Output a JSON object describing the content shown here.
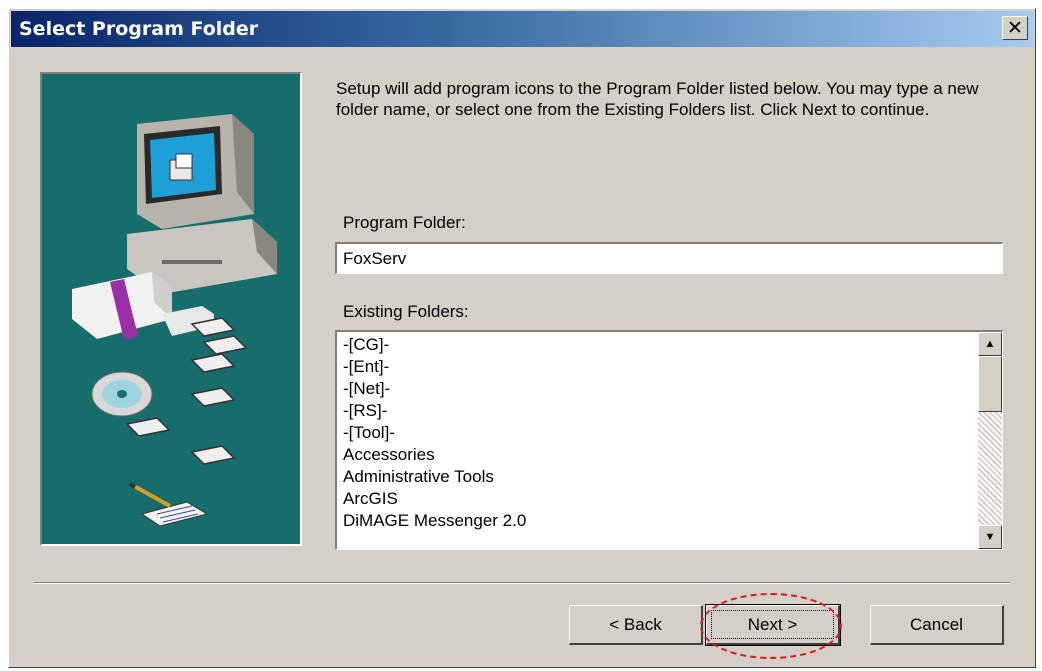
{
  "window": {
    "title": "Select Program Folder",
    "close_glyph": "✕"
  },
  "description": "Setup will add program icons to the Program Folder listed below. You may type a new folder name, or select one from the Existing Folders list. Click Next to continue.",
  "program_folder": {
    "label": "Program Folder:",
    "value": "FoxServ"
  },
  "existing_folders": {
    "label": "Existing Folders:",
    "items": [
      "-[CG]-",
      "-[Ent]-",
      "-[Net]-",
      "-[RS]-",
      "-[Tool]-",
      "Accessories",
      "Administrative Tools",
      "ArcGIS",
      "DiMAGE Messenger 2.0"
    ]
  },
  "buttons": {
    "back": "< Back",
    "next": "Next >",
    "cancel": "Cancel"
  },
  "icons": {
    "artwork": "setup-wizard-computer-icon",
    "scroll_up": "scroll-up-arrow-icon",
    "scroll_down": "scroll-down-arrow-icon"
  },
  "colors": {
    "title_bar_start": "#0a246a",
    "title_bar_end": "#a6caf0",
    "dialog_face": "#d4d0c8",
    "artwork_background": "#176c6c",
    "annotation_ring": "#e3161b"
  }
}
